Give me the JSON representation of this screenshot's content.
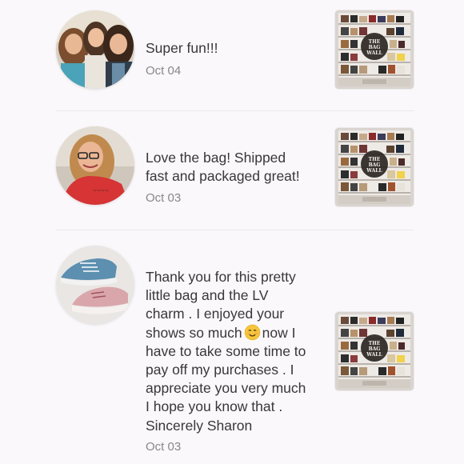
{
  "reviews": [
    {
      "avatar_icon": "avatar-group-photo",
      "message_lines": [
        "Super fun!!!"
      ],
      "date": "Oct 04",
      "thumbnail": {
        "icon": "bag-wall-thumbnail",
        "caption": "THE BAG WALL"
      }
    },
    {
      "avatar_icon": "avatar-person-photo",
      "message_lines": [
        "Love the bag! Shipped",
        "fast and packaged great!"
      ],
      "date": "Oct 03",
      "thumbnail": {
        "icon": "bag-wall-thumbnail",
        "caption": "THE BAG WALL"
      }
    },
    {
      "avatar_icon": "avatar-sneakers-photo",
      "message_lines": [
        "Thank you for this pretty",
        "little bag and the LV",
        "charm . I enjoyed your",
        "shows so much",
        "have to take some time to",
        "pay off my purchases . I",
        "appreciate you very much",
        "I hope you know that .",
        "Sincerely Sharon"
      ],
      "message_line_4_after_emoji": "now I",
      "emoji": "smiling-face-emoji",
      "date": "Oct 03",
      "thumbnail": {
        "icon": "bag-wall-thumbnail",
        "caption": "THE BAG WALL"
      }
    }
  ],
  "colors": {
    "background": "#faf8fa",
    "text": "#3a363b",
    "date": "#8a868c",
    "divider": "#ece8ec"
  }
}
